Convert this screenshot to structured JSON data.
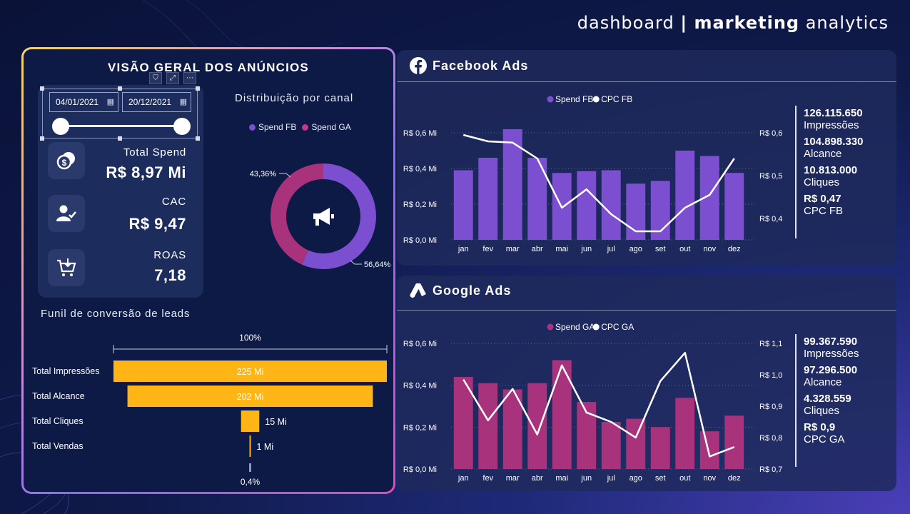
{
  "title": {
    "light_a": "dashboard ",
    "sep": "| ",
    "bold": "marketing",
    "light_b": " analytics"
  },
  "left": {
    "title": "VISÃO GERAL DOS ANÚNCIOS",
    "date_start": "04/01/2021",
    "date_end": "20/12/2021",
    "kpis": [
      {
        "label": "Total Spend",
        "value": "R$ 8,97 Mi",
        "icon": "coins-icon"
      },
      {
        "label": "CAC",
        "value": "R$ 9,47",
        "icon": "user-check-icon"
      },
      {
        "label": "ROAS",
        "value": "7,18",
        "icon": "cart-icon"
      }
    ],
    "donut_title": "Distribuição por canal",
    "funnel_title": "Funil de conversão de leads"
  },
  "colors": {
    "fb": "#7b4fd0",
    "ga": "#a8327c",
    "funnel": "#ffb516",
    "line": "#ffffff"
  },
  "chart_data": [
    {
      "type": "pie",
      "title": "Distribuição por canal",
      "categories": [
        "Spend FB",
        "Spend GA"
      ],
      "values": [
        56.64,
        43.36
      ],
      "labels": [
        "56,64%",
        "43,36%"
      ],
      "legend": "top"
    },
    {
      "type": "bar",
      "title": "Funil de conversão de leads",
      "categories": [
        "Total Impressões",
        "Total Alcance",
        "Total Cliques",
        "Total Vendas"
      ],
      "values": [
        225,
        202,
        15,
        1
      ],
      "labels": [
        "225 Mi",
        "202 Mi",
        "15 Mi",
        "1 Mi"
      ],
      "top_label": "100%",
      "bottom_label": "0,4%"
    },
    {
      "type": "bar",
      "title": "Facebook Ads",
      "categories": [
        "jan",
        "fev",
        "mar",
        "abr",
        "mai",
        "jun",
        "jul",
        "ago",
        "set",
        "out",
        "nov",
        "dez"
      ],
      "series": [
        {
          "name": "Spend FB",
          "values": [
            0.39,
            0.46,
            0.62,
            0.46,
            0.375,
            0.385,
            0.39,
            0.315,
            0.33,
            0.5,
            0.47,
            0.375
          ]
        },
        {
          "name": "CPC FB",
          "type": "line",
          "axis": "right",
          "values": [
            0.595,
            0.58,
            0.577,
            0.54,
            0.425,
            0.468,
            0.41,
            0.37,
            0.37,
            0.425,
            0.455,
            0.54
          ]
        }
      ],
      "ylim": [
        0,
        0.6
      ],
      "yticks": [
        "R$ 0,0 Mi",
        "R$ 0,2 Mi",
        "R$ 0,4 Mi",
        "R$ 0,6 Mi"
      ],
      "y2lim": [
        0.35,
        0.6
      ],
      "y2ticks": [
        "R$ 0,4",
        "R$ 0,5",
        "R$ 0,6"
      ],
      "legend": "top-center",
      "stats": [
        {
          "value": "126.115.650",
          "label": "Impressões"
        },
        {
          "value": "104.898.330",
          "label": "Alcance"
        },
        {
          "value": "10.813.000",
          "label": "Cliques"
        },
        {
          "value": "R$ 0,47",
          "label": "CPC FB"
        }
      ]
    },
    {
      "type": "bar",
      "title": "Google Ads",
      "categories": [
        "jan",
        "fev",
        "mar",
        "abr",
        "mai",
        "jun",
        "jul",
        "ago",
        "set",
        "out",
        "nov",
        "dez"
      ],
      "series": [
        {
          "name": "Spend GA",
          "values": [
            0.44,
            0.41,
            0.38,
            0.41,
            0.52,
            0.32,
            0.225,
            0.24,
            0.2,
            0.34,
            0.18,
            0.255
          ]
        },
        {
          "name": "CPC GA",
          "type": "line",
          "axis": "right",
          "values": [
            0.985,
            0.855,
            0.955,
            0.81,
            1.03,
            0.88,
            0.85,
            0.8,
            0.98,
            1.07,
            0.74,
            0.77
          ]
        }
      ],
      "ylim": [
        0,
        0.6
      ],
      "yticks": [
        "R$ 0,0 Mi",
        "R$ 0,2 Mi",
        "R$ 0,4 Mi",
        "R$ 0,6 Mi"
      ],
      "y2lim": [
        0.7,
        1.1
      ],
      "y2ticks": [
        "R$ 0,7",
        "R$ 0,8",
        "R$ 0,9",
        "R$ 1,0",
        "R$ 1,1"
      ],
      "legend": "top-center",
      "stats": [
        {
          "value": "99.367.590",
          "label": "Impressões"
        },
        {
          "value": "97.296.500",
          "label": "Alcance"
        },
        {
          "value": "4.328.559",
          "label": "Cliques"
        },
        {
          "value": "R$ 0,9",
          "label": "CPC GA"
        }
      ]
    }
  ]
}
